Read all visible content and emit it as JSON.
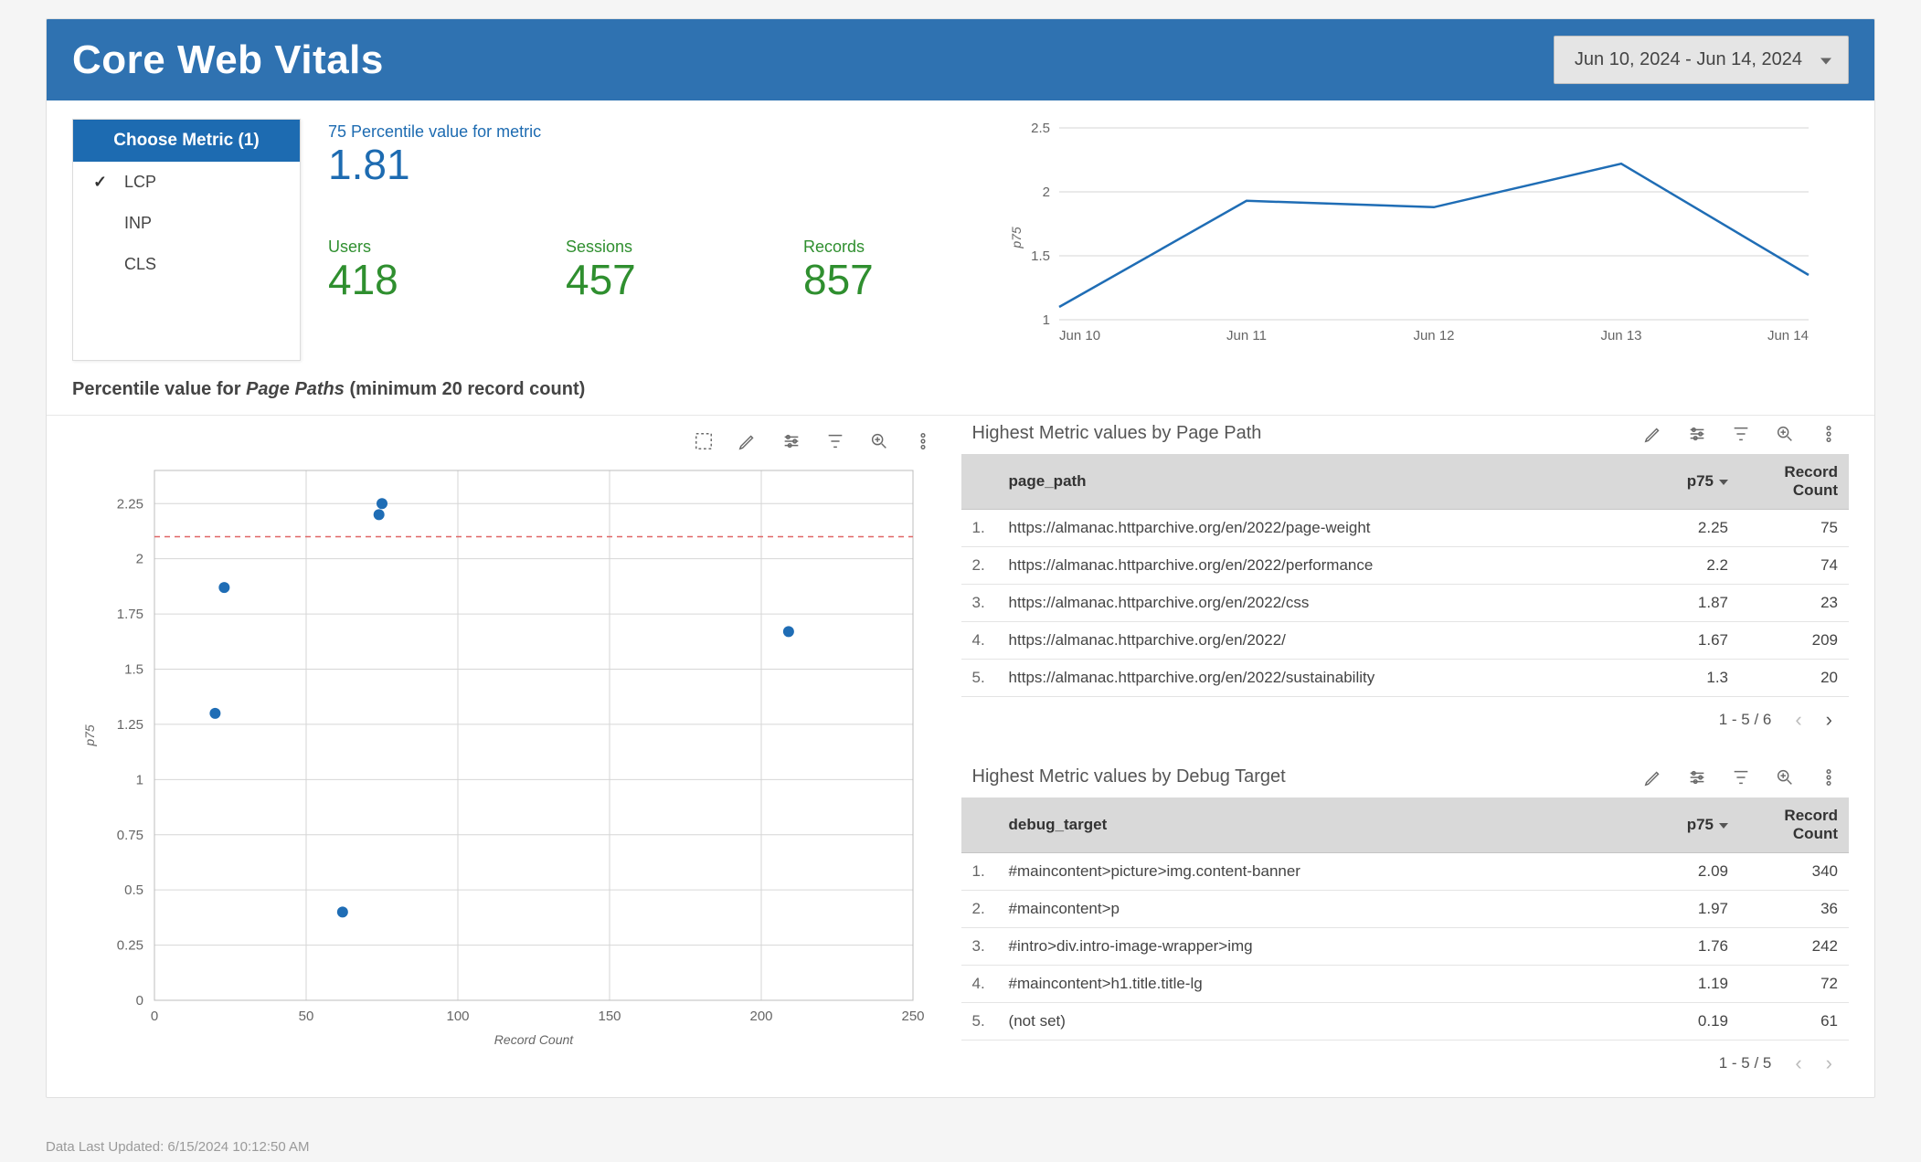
{
  "header": {
    "title": "Core Web Vitals",
    "date_range": "Jun 10, 2024 - Jun 14, 2024"
  },
  "metric_select": {
    "label": "Choose Metric (1)",
    "items": [
      {
        "name": "LCP",
        "selected": true
      },
      {
        "name": "INP",
        "selected": false
      },
      {
        "name": "CLS",
        "selected": false
      }
    ]
  },
  "top_stats": {
    "p75_label": "75 Percentile value for metric",
    "p75_value": "1.81",
    "users_label": "Users",
    "users_value": "418",
    "sessions_label": "Sessions",
    "sessions_value": "457",
    "records_label": "Records",
    "records_value": "857"
  },
  "section_title": {
    "prefix": "Percentile value for ",
    "emph": "Page Paths",
    "suffix": " (minimum 20 record count)"
  },
  "page_path_table": {
    "title": "Highest Metric values by Page Path",
    "columns": {
      "path": "page_path",
      "p75": "p75",
      "count": "Record Count"
    },
    "rows": [
      {
        "idx": "1.",
        "path": "https://almanac.httparchive.org/en/2022/page-weight",
        "p75": "2.25",
        "count": "75"
      },
      {
        "idx": "2.",
        "path": "https://almanac.httparchive.org/en/2022/performance",
        "p75": "2.2",
        "count": "74"
      },
      {
        "idx": "3.",
        "path": "https://almanac.httparchive.org/en/2022/css",
        "p75": "1.87",
        "count": "23"
      },
      {
        "idx": "4.",
        "path": "https://almanac.httparchive.org/en/2022/",
        "p75": "1.67",
        "count": "209"
      },
      {
        "idx": "5.",
        "path": "https://almanac.httparchive.org/en/2022/sustainability",
        "p75": "1.3",
        "count": "20"
      }
    ],
    "pager": "1 - 5 / 6"
  },
  "debug_target_table": {
    "title": "Highest Metric values by Debug Target",
    "columns": {
      "target": "debug_target",
      "p75": "p75",
      "count": "Record Count"
    },
    "rows": [
      {
        "idx": "1.",
        "target": "#maincontent>picture>img.content-banner",
        "p75": "2.09",
        "count": "340"
      },
      {
        "idx": "2.",
        "target": "#maincontent>p",
        "p75": "1.97",
        "count": "36"
      },
      {
        "idx": "3.",
        "target": "#intro>div.intro-image-wrapper>img",
        "p75": "1.76",
        "count": "242"
      },
      {
        "idx": "4.",
        "target": "#maincontent>h1.title.title-lg",
        "p75": "1.19",
        "count": "72"
      },
      {
        "idx": "5.",
        "target": "(not set)",
        "p75": "0.19",
        "count": "61"
      }
    ],
    "pager": "1 - 5 / 5"
  },
  "footer": "Data Last Updated: 6/15/2024 10:12:50 AM",
  "chart_data": [
    {
      "type": "line",
      "title": "p75 over time",
      "xlabel": "",
      "ylabel": "p75",
      "ylim": [
        1,
        2.5
      ],
      "categories": [
        "Jun 10",
        "Jun 11",
        "Jun 12",
        "Jun 13",
        "Jun 14"
      ],
      "values": [
        1.1,
        1.93,
        1.88,
        2.22,
        1.35
      ]
    },
    {
      "type": "scatter",
      "title": "Percentile value for Page Paths",
      "xlabel": "Record Count",
      "ylabel": "p75",
      "xlim": [
        0,
        250
      ],
      "ylim": [
        0,
        2.4
      ],
      "reference_line_y": 2.1,
      "points": [
        {
          "x": 75,
          "y": 2.25
        },
        {
          "x": 74,
          "y": 2.2
        },
        {
          "x": 23,
          "y": 1.87
        },
        {
          "x": 209,
          "y": 1.67
        },
        {
          "x": 20,
          "y": 1.3
        },
        {
          "x": 62,
          "y": 0.4
        }
      ]
    }
  ]
}
